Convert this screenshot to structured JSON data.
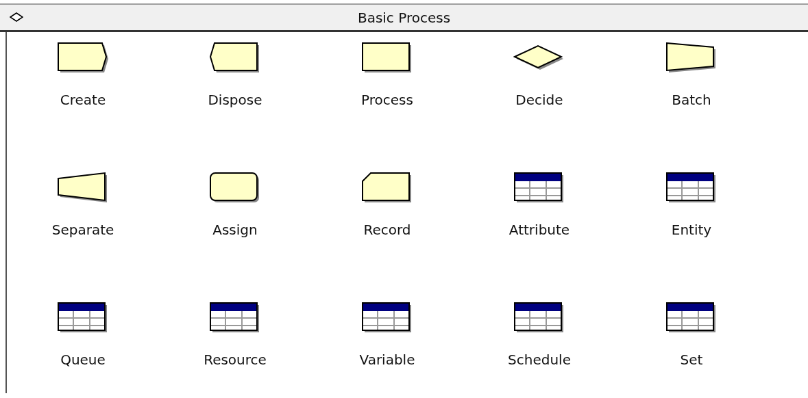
{
  "panel": {
    "title": "Basic Process",
    "expanded": true
  },
  "modules": [
    {
      "label": "Create",
      "kind": "create"
    },
    {
      "label": "Dispose",
      "kind": "dispose"
    },
    {
      "label": "Process",
      "kind": "process"
    },
    {
      "label": "Decide",
      "kind": "decide"
    },
    {
      "label": "Batch",
      "kind": "batch"
    },
    {
      "label": "Separate",
      "kind": "separate"
    },
    {
      "label": "Assign",
      "kind": "assign"
    },
    {
      "label": "Record",
      "kind": "record"
    },
    {
      "label": "Attribute",
      "kind": "table"
    },
    {
      "label": "Entity",
      "kind": "table"
    },
    {
      "label": "Queue",
      "kind": "table"
    },
    {
      "label": "Resource",
      "kind": "table"
    },
    {
      "label": "Variable",
      "kind": "table"
    },
    {
      "label": "Schedule",
      "kind": "table"
    },
    {
      "label": "Set",
      "kind": "table"
    }
  ]
}
